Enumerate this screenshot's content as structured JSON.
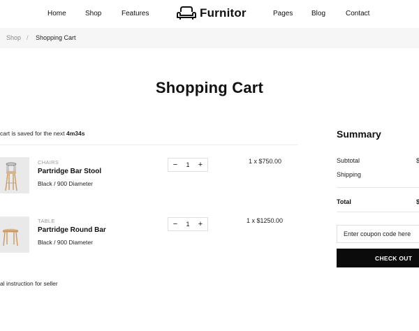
{
  "nav": {
    "left": [
      "Home",
      "Shop",
      "Features"
    ],
    "right": [
      "Pages",
      "Blog",
      "Contact"
    ]
  },
  "logo": {
    "text": "Furnitor",
    "icon": "armchair-icon"
  },
  "breadcrumb": {
    "shop": "Shop",
    "separator": "/",
    "current": "Shopping Cart"
  },
  "page_title": "Shopping Cart",
  "cart_notice": {
    "text": "cart is saved for the next ",
    "time": "4m34s"
  },
  "items": [
    {
      "category": "CHAIRS",
      "name": "Partridge Bar Stool",
      "variant": "Black / 900 Diameter",
      "quantity": "1",
      "price": "1 x $750.00",
      "thumb_icon": "bar-stool-icon"
    },
    {
      "category": "TABLE",
      "name": "Partridge Round Bar",
      "variant": "Black / 900 Diameter",
      "quantity": "1",
      "price": "1 x $1250.00",
      "thumb_icon": "round-table-icon"
    }
  ],
  "qty_controls": {
    "minus": "−",
    "plus": "+"
  },
  "instruction": "al instruction for seller",
  "summary": {
    "title": "Summary",
    "subtotal_label": "Subtotal",
    "subtotal_value": "$",
    "shipping_label": "Shipping",
    "total_label": "Total",
    "total_value": "$",
    "coupon_placeholder": "Enter coupon code here",
    "checkout_label": "CHECK OUT"
  },
  "colors": {
    "accent": "#0b0b0b",
    "breadcrumb_bg": "#f6f6f6",
    "thumb_bg": "#e9e9e9"
  }
}
